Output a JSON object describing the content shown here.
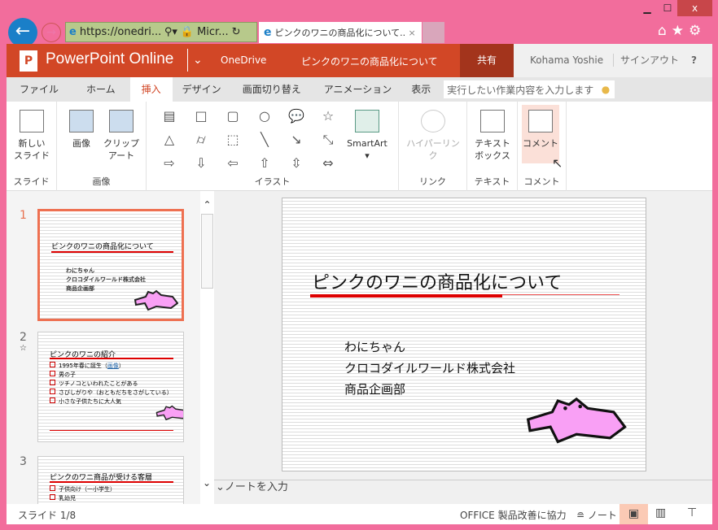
{
  "window": {
    "minimize": "▁",
    "maximize": "☐",
    "close": "x"
  },
  "browser": {
    "address": "https://onedri...",
    "cert": "Micr...",
    "tab_title": "ピンクのワニの商品化について....",
    "tab_close": "×"
  },
  "app": {
    "name": "PowerPoint Online",
    "location": "OneDrive",
    "doc_title": "ピンクのワニの商品化について",
    "share": "共有",
    "user": "Kohama Yoshie",
    "signout": "サインアウト",
    "help": "?"
  },
  "ribbon_tabs": [
    {
      "label": "ファイル"
    },
    {
      "label": "ホーム"
    },
    {
      "label": "挿入",
      "active": true
    },
    {
      "label": "デザイン"
    },
    {
      "label": "画面切り替え"
    },
    {
      "label": "アニメーション"
    },
    {
      "label": "表示"
    }
  ],
  "tell_me": {
    "placeholder": "実行したい作業内容を入力します"
  },
  "ribbon": {
    "groups": [
      {
        "label": "スライド"
      },
      {
        "label": "画像"
      },
      {
        "label": "イラスト"
      },
      {
        "label": "リンク"
      },
      {
        "label": "テキスト"
      },
      {
        "label": "コメント"
      }
    ],
    "new_slide": [
      "新しい",
      "スライド"
    ],
    "picture": "画像",
    "clipart": [
      "クリップ",
      "アート"
    ],
    "smartart": "SmartArt",
    "hyperlink": "ハイパーリンク",
    "textbox": [
      "テキスト",
      "ボックス"
    ],
    "comment": "コメント",
    "shapes": [
      "▤",
      "□",
      "▢",
      "○",
      "💬",
      "☆",
      "△",
      "⌭",
      "⬚",
      "╲",
      "↘",
      "⤡",
      "⇨",
      "⇩",
      "⇦",
      "⇧",
      "⇳",
      "⇔"
    ]
  },
  "thumbnails": [
    {
      "num": "1",
      "title": "ピンクのワニの商品化について",
      "lines": [
        "わにちゃん",
        "クロコダイルワールド株式会社",
        "商品企画部"
      ]
    },
    {
      "num": "2",
      "title": "ピンクのワニの紹介",
      "lines": [
        "1995年春に誕生（",
        "男の子",
        "ツチノコといわれたことがある",
        "さびしがりや（おともだちをさがしている）",
        "小さな子供たちに大人気"
      ],
      "link": "画像",
      "star": "☆"
    },
    {
      "num": "3",
      "title": "ピンクのワニ商品が受ける客層",
      "lines": [
        "子供向け（一小学生）",
        "乳幼児"
      ]
    }
  ],
  "slide": {
    "title": "ピンクのワニの商品化について",
    "subtitle": [
      "わにちゃん",
      "クロコダイルワールド株式会社",
      "商品企画部"
    ]
  },
  "notes": {
    "placeholder": "ノートを入力"
  },
  "status": {
    "slide": "スライド 1/8",
    "feedback": "OFFICE 製品改善に協力",
    "notes": "ノート"
  },
  "colors": {
    "accent": "#d24726",
    "window": "#f26d9c",
    "share": "#a3341c"
  }
}
